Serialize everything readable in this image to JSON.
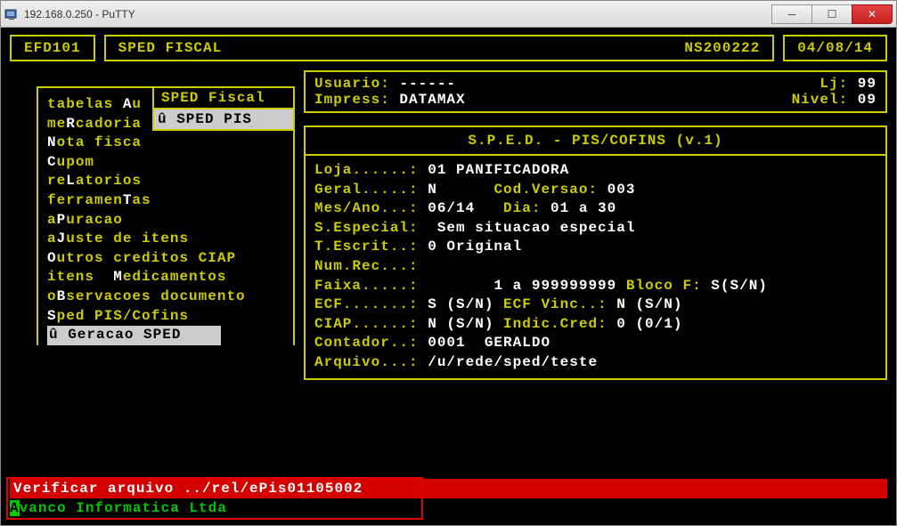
{
  "window": {
    "title": "192.168.0.250 - PuTTY"
  },
  "header": {
    "code": "EFD101",
    "title": "SPED FISCAL",
    "station": "NS200222",
    "date": "04/08/14"
  },
  "userinfo": {
    "usuario_lbl": "Usuario: ",
    "usuario_val": "------",
    "lj_lbl": "Lj: ",
    "lj_val": "99",
    "impress_lbl": "Impress: ",
    "impress_val": "DATAMAX",
    "nivel_lbl": "Nivel: ",
    "nivel_val": "09"
  },
  "menu": {
    "items": [
      {
        "pre": "tabelas ",
        "hot": "A",
        "post": "u"
      },
      {
        "pre": "me",
        "hot": "R",
        "post": "cadoria"
      },
      {
        "pre": "",
        "hot": "N",
        "post": "ota fisca"
      },
      {
        "pre": "",
        "hot": "C",
        "post": "upom"
      },
      {
        "pre": "re",
        "hot": "L",
        "post": "atorios"
      },
      {
        "pre": "ferramen",
        "hot": "T",
        "post": "as"
      },
      {
        "pre": "a",
        "hot": "P",
        "post": "uracao"
      },
      {
        "pre": "a",
        "hot": "J",
        "post": "uste de itens"
      },
      {
        "pre": "",
        "hot": "O",
        "post": "utros creditos CIAP"
      },
      {
        "pre": "itens  ",
        "hot": "M",
        "post": "edicamentos"
      },
      {
        "pre": "o",
        "hot": "B",
        "post": "servacoes documento"
      },
      {
        "pre": "",
        "hot": "S",
        "post": "ped PIS/Cofins"
      }
    ],
    "selected": "û Geracao SPED    "
  },
  "submenu": {
    "head": " SPED Fiscal",
    "sel": "û SPED PIS  "
  },
  "panel": {
    "title": "S.P.E.D. - PIS/COFINS (v.1)",
    "lines": [
      {
        "l": "Loja......: ",
        "w": "01 PANIFICADORA"
      },
      {
        "l": "Geral.....: ",
        "w": "N      ",
        "l2": "Cod.Versao: ",
        "w2": "003"
      },
      {
        "l": "Mes/Ano...: ",
        "w": "06/14   ",
        "l2": "Dia: ",
        "w2": "01 a 30"
      },
      {
        "l": "S.Especial:  ",
        "w": "Sem situacao especial"
      },
      {
        "l": "T.Escrit..: ",
        "w": "0 Original"
      },
      {
        "l": "Num.Rec...:",
        "w": ""
      },
      {
        "l": "Faixa.....:        ",
        "w": "1 a 999999999 ",
        "l2": "Bloco F: ",
        "w2": "S(S/N)"
      },
      {
        "l": "ECF.......: ",
        "w": "S (S/N) ",
        "l2": "ECF Vinc..: ",
        "w2": "N (S/N)"
      },
      {
        "l": "CIAP......: ",
        "w": "N (S/N) ",
        "l2": "Indic.Cred: ",
        "w2": "0 (0/1)"
      },
      {
        "l": "Contador..: ",
        "w": "0001  GERALDO"
      },
      {
        "l": "Arquivo...: ",
        "w": "/u/rede/sped/teste"
      }
    ]
  },
  "status": "Verificar arquivo ../rel/ePis01105002",
  "footer": "Avanco Informatica Ltda"
}
